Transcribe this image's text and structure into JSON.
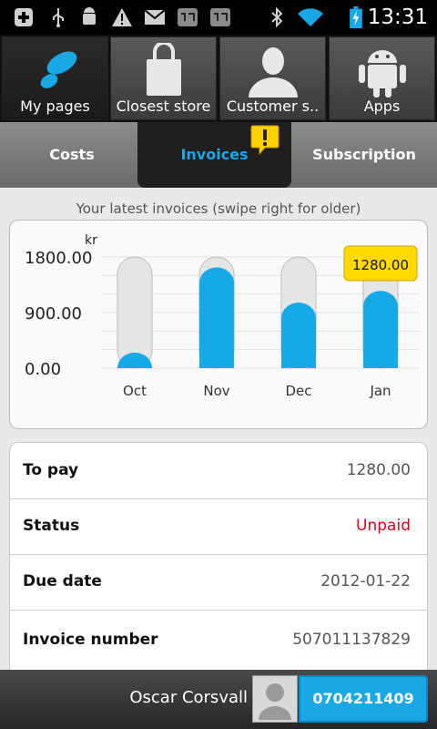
{
  "status_bar": {
    "time": "13:31",
    "icons": [
      "add-icon",
      "usb-icon",
      "android-debug-icon",
      "warning-icon",
      "gmail-icon",
      "photo-icon",
      "photo-icon",
      "bluetooth-icon",
      "wifi-icon",
      "battery-charging-icon"
    ]
  },
  "nav": {
    "items": [
      {
        "label": "My pages",
        "icon": "telenor-logo-icon"
      },
      {
        "label": "Closest store",
        "icon": "shopping-bag-icon"
      },
      {
        "label": "Customer s..",
        "icon": "person-icon"
      },
      {
        "label": "Apps",
        "icon": "android-icon"
      }
    ]
  },
  "tabs": {
    "items": [
      {
        "label": "Costs"
      },
      {
        "label": "Invoices"
      },
      {
        "label": "Subscription"
      }
    ],
    "active": "Invoices"
  },
  "chart_caption": "Your latest invoices (swipe right for older)",
  "chart_data": {
    "type": "bar",
    "categories": [
      "Oct",
      "Nov",
      "Dec",
      "Jan"
    ],
    "values": [
      260,
      1660,
      1090,
      1280
    ],
    "ylabel": "kr",
    "yticks": [
      "1800.00",
      "900.00",
      "0.00"
    ],
    "ylim": [
      0,
      1800
    ],
    "highlight_label": "1280.00",
    "colors": {
      "bar": "#15a9e8",
      "track": "#e6e6e6",
      "tooltip": "#ffd900"
    }
  },
  "details": {
    "rows": [
      {
        "label": "To pay",
        "value": "1280.00"
      },
      {
        "label": "Status",
        "value": "Unpaid"
      },
      {
        "label": "Due date",
        "value": "2012-01-22"
      },
      {
        "label": "Invoice number",
        "value": "507011137829"
      }
    ]
  },
  "footer": {
    "user_name": "Oscar Corsvall",
    "phone": "0704211409"
  },
  "colors": {
    "accent": "#1aa7e6",
    "unpaid": "#e0001b"
  }
}
